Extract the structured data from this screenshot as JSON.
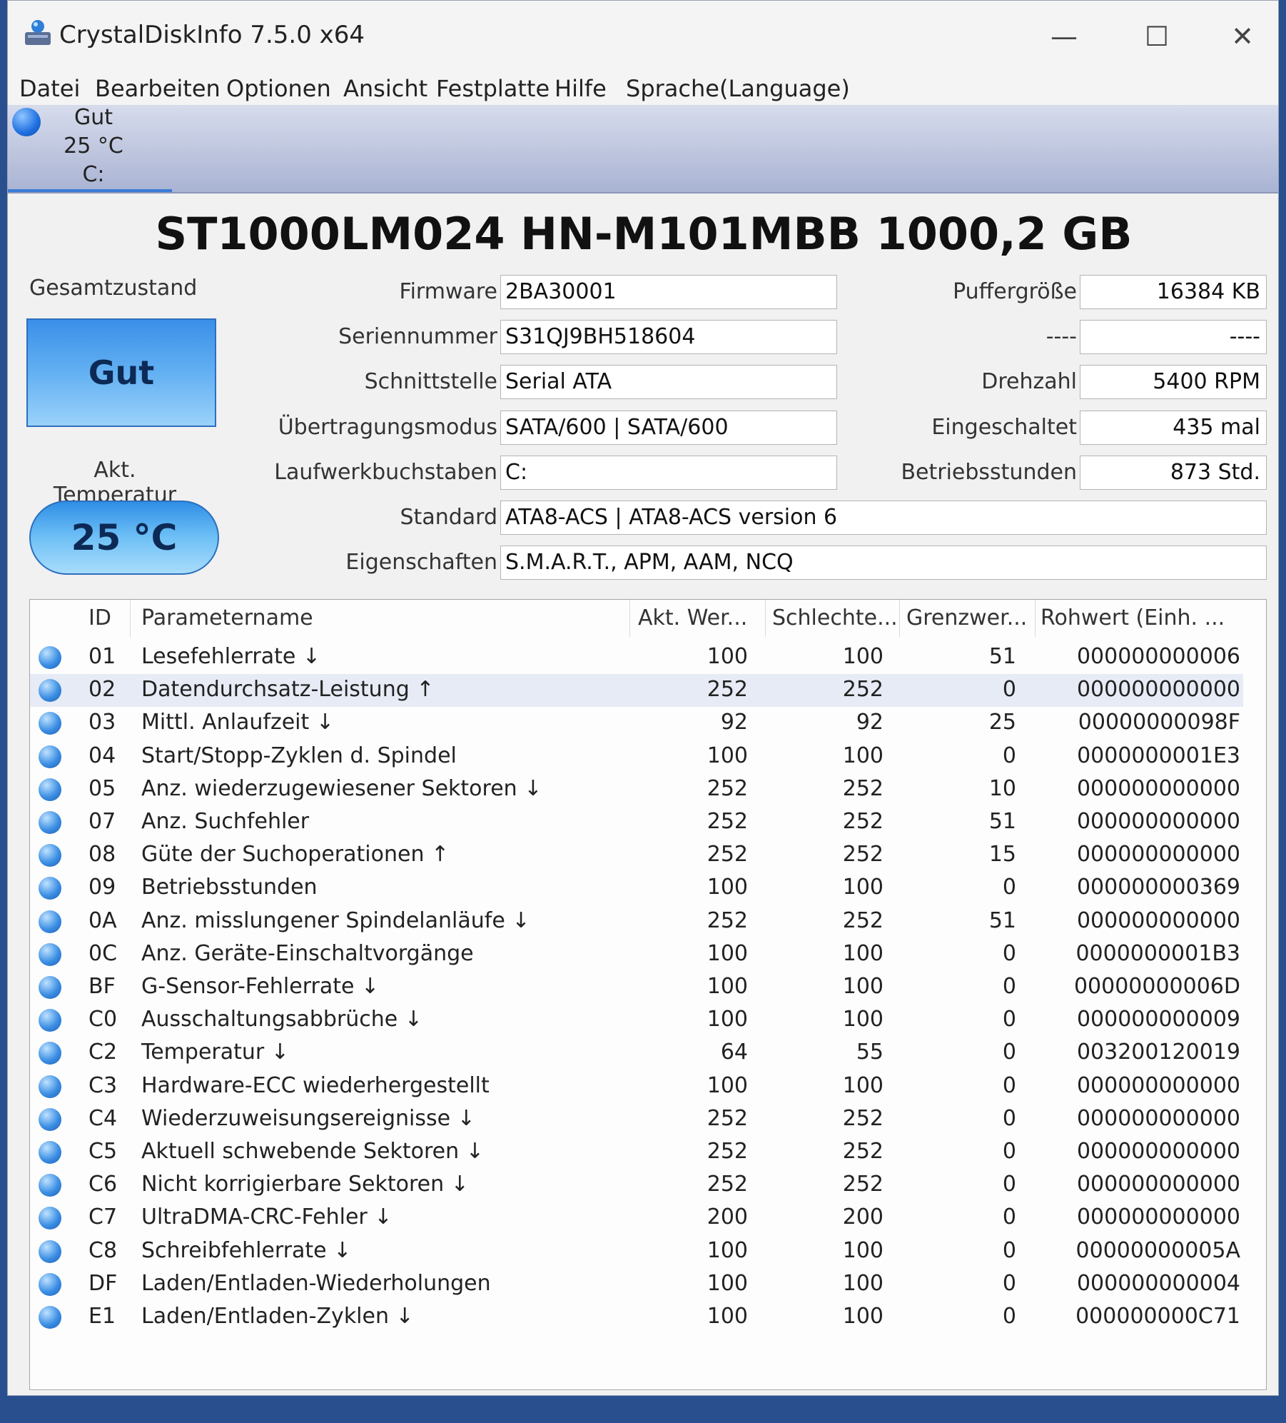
{
  "window": {
    "title": "CrystalDiskInfo 7.5.0 x64",
    "minimize": "—",
    "maximize": "☐",
    "close": "✕"
  },
  "menu": [
    "Datei",
    "Bearbeiten",
    "Optionen",
    "Ansicht",
    "Festplatte",
    "Hilfe",
    "Sprache(Language)"
  ],
  "drive_tab": {
    "status": "Gut",
    "temperature": "25 °C",
    "letter": "C:",
    "status_color": "#1e6fe0"
  },
  "model_title": "ST1000LM024 HN-M101MBB 1000,2 GB",
  "health": {
    "label": "Gesamtzustand",
    "value": "Gut",
    "color": "#3a8fe8"
  },
  "temperature": {
    "label": "Akt. Temperatur",
    "value": "25 °C"
  },
  "info": {
    "firmware": {
      "label": "Firmware",
      "value": "2BA30001"
    },
    "serial": {
      "label": "Seriennummer",
      "value": "S31QJ9BH518604"
    },
    "interface": {
      "label": "Schnittstelle",
      "value": "Serial ATA"
    },
    "transfer_mode": {
      "label": "Übertragungsmodus",
      "value": "SATA/600 | SATA/600"
    },
    "drive_letter": {
      "label": "Laufwerkbuchstaben",
      "value": "C:"
    },
    "standard": {
      "label": "Standard",
      "value": "ATA8-ACS | ATA8-ACS version 6"
    },
    "features": {
      "label": "Eigenschaften",
      "value": "S.M.A.R.T., APM, AAM, NCQ"
    },
    "buffer": {
      "label": "Puffergröße",
      "value": "16384 KB"
    },
    "nv_cache": {
      "label": "----",
      "value": "----"
    },
    "rotation": {
      "label": "Drehzahl",
      "value": "5400 RPM"
    },
    "power_on_count": {
      "label": "Eingeschaltet",
      "value": "435 mal"
    },
    "power_on_hours": {
      "label": "Betriebsstunden",
      "value": "873 Std."
    }
  },
  "smart": {
    "headers": [
      "ID",
      "Parametername",
      "Akt. Wer...",
      "Schlechte...",
      "Grenzwer...",
      "Rohwert (Einh. ..."
    ],
    "rows": [
      {
        "id": "01",
        "name": "Lesefehlerrate ↓",
        "current": "100",
        "worst": "100",
        "threshold": "51",
        "raw": "000000000006"
      },
      {
        "id": "02",
        "name": "Datendurchsatz-Leistung ↑",
        "current": "252",
        "worst": "252",
        "threshold": "0",
        "raw": "000000000000"
      },
      {
        "id": "03",
        "name": "Mittl. Anlaufzeit ↓",
        "current": "92",
        "worst": "92",
        "threshold": "25",
        "raw": "00000000098F"
      },
      {
        "id": "04",
        "name": "Start/Stopp-Zyklen d. Spindel",
        "current": "100",
        "worst": "100",
        "threshold": "0",
        "raw": "0000000001E3"
      },
      {
        "id": "05",
        "name": "Anz. wiederzugewiesener Sektoren ↓",
        "current": "252",
        "worst": "252",
        "threshold": "10",
        "raw": "000000000000"
      },
      {
        "id": "07",
        "name": "Anz. Suchfehler",
        "current": "252",
        "worst": "252",
        "threshold": "51",
        "raw": "000000000000"
      },
      {
        "id": "08",
        "name": "Güte der Suchoperationen ↑",
        "current": "252",
        "worst": "252",
        "threshold": "15",
        "raw": "000000000000"
      },
      {
        "id": "09",
        "name": "Betriebsstunden",
        "current": "100",
        "worst": "100",
        "threshold": "0",
        "raw": "000000000369"
      },
      {
        "id": "0A",
        "name": "Anz. misslungener Spindelanläufe ↓",
        "current": "252",
        "worst": "252",
        "threshold": "51",
        "raw": "000000000000"
      },
      {
        "id": "0C",
        "name": "Anz. Geräte-Einschaltvorgänge",
        "current": "100",
        "worst": "100",
        "threshold": "0",
        "raw": "0000000001B3"
      },
      {
        "id": "BF",
        "name": "G-Sensor-Fehlerrate ↓",
        "current": "100",
        "worst": "100",
        "threshold": "0",
        "raw": "00000000006D"
      },
      {
        "id": "C0",
        "name": "Ausschaltungsabbrüche ↓",
        "current": "100",
        "worst": "100",
        "threshold": "0",
        "raw": "000000000009"
      },
      {
        "id": "C2",
        "name": "Temperatur ↓",
        "current": "64",
        "worst": "55",
        "threshold": "0",
        "raw": "003200120019"
      },
      {
        "id": "C3",
        "name": "Hardware-ECC wiederhergestellt",
        "current": "100",
        "worst": "100",
        "threshold": "0",
        "raw": "000000000000"
      },
      {
        "id": "C4",
        "name": "Wiederzuweisungsereignisse ↓",
        "current": "252",
        "worst": "252",
        "threshold": "0",
        "raw": "000000000000"
      },
      {
        "id": "C5",
        "name": "Aktuell schwebende Sektoren ↓",
        "current": "252",
        "worst": "252",
        "threshold": "0",
        "raw": "000000000000"
      },
      {
        "id": "C6",
        "name": "Nicht korrigierbare Sektoren ↓",
        "current": "252",
        "worst": "252",
        "threshold": "0",
        "raw": "000000000000"
      },
      {
        "id": "C7",
        "name": "UltraDMA-CRC-Fehler ↓",
        "current": "200",
        "worst": "200",
        "threshold": "0",
        "raw": "000000000000"
      },
      {
        "id": "C8",
        "name": "Schreibfehlerrate ↓",
        "current": "100",
        "worst": "100",
        "threshold": "0",
        "raw": "00000000005A"
      },
      {
        "id": "DF",
        "name": "Laden/Entladen-Wiederholungen",
        "current": "100",
        "worst": "100",
        "threshold": "0",
        "raw": "000000000004"
      },
      {
        "id": "E1",
        "name": "Laden/Entladen-Zyklen ↓",
        "current": "100",
        "worst": "100",
        "threshold": "0",
        "raw": "000000000C71"
      }
    ]
  }
}
